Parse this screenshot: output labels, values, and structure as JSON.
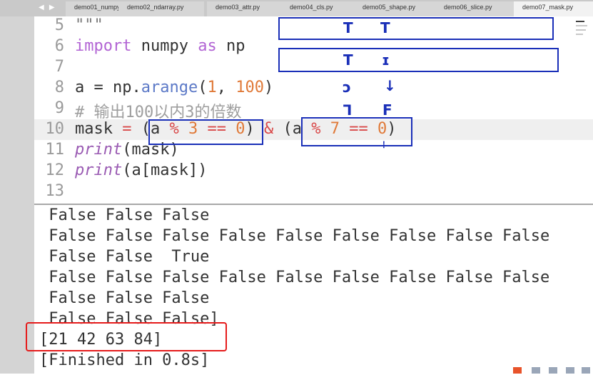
{
  "tabs": [
    {
      "label": "demo01_numpy"
    },
    {
      "label": "demo02_ndarray.py"
    },
    {
      "label": "demo03_attr.py"
    },
    {
      "label": "demo04_cls.py"
    },
    {
      "label": "demo05_shape.py"
    },
    {
      "label": "demo06_slice.py"
    },
    {
      "label": "demo07_mask.py",
      "active": true
    }
  ],
  "nav": {
    "arrows": "◀ ▶"
  },
  "editor": {
    "line_numbers": [
      "5",
      "6",
      "7",
      "8",
      "9",
      "10",
      "11",
      "12",
      "13"
    ],
    "current_line": "10",
    "lines": {
      "l5": "\"\"\"",
      "l6_kw_import": "import",
      "l6_mod": " numpy ",
      "l6_kw_as": "as",
      "l6_alias": " np",
      "l8_a": "a = np.",
      "l8_fn": "arange",
      "l8_open": "(",
      "l8_n1": "1",
      "l8_comma": ", ",
      "l8_n2": "100",
      "l8_close": ")",
      "l9_comment": "# 输出100以内3的倍数",
      "l10_mask": "mask ",
      "l10_eq": "=",
      "l10_p1": " (a ",
      "l10_mod1": "%",
      "l10_n3": " 3 ",
      "l10_eqeq1": "==",
      "l10_z1": " 0",
      "l10_mid": ") ",
      "l10_amp": "&",
      "l10_p2": " (a ",
      "l10_mod2": "%",
      "l10_n7": " 7 ",
      "l10_eqeq2": "==",
      "l10_z2": " 0",
      "l10_end": ")",
      "l11_print": "print",
      "l11_rest": "(mask)",
      "l12_print": "print",
      "l12_rest": "(a[mask])"
    }
  },
  "annotations": {
    "marks": [
      "T",
      "T",
      "T",
      "ɪ",
      "ↄ",
      "↓",
      "⅂",
      "F",
      "⸸"
    ]
  },
  "console": {
    "lines": [
      " False False False",
      " False False False False False False False False False",
      " False False  True",
      " False False False False False False False False False",
      " False False False",
      " False False False]",
      "[21 42 63 84]",
      "[Finished in 0.8s]"
    ]
  },
  "colors": {
    "annotation_blue": "#1a2fb8",
    "highlight_red": "#e51b1b",
    "keyword": "#b264d4",
    "number": "#e07a39",
    "operator": "#d94a4a"
  }
}
